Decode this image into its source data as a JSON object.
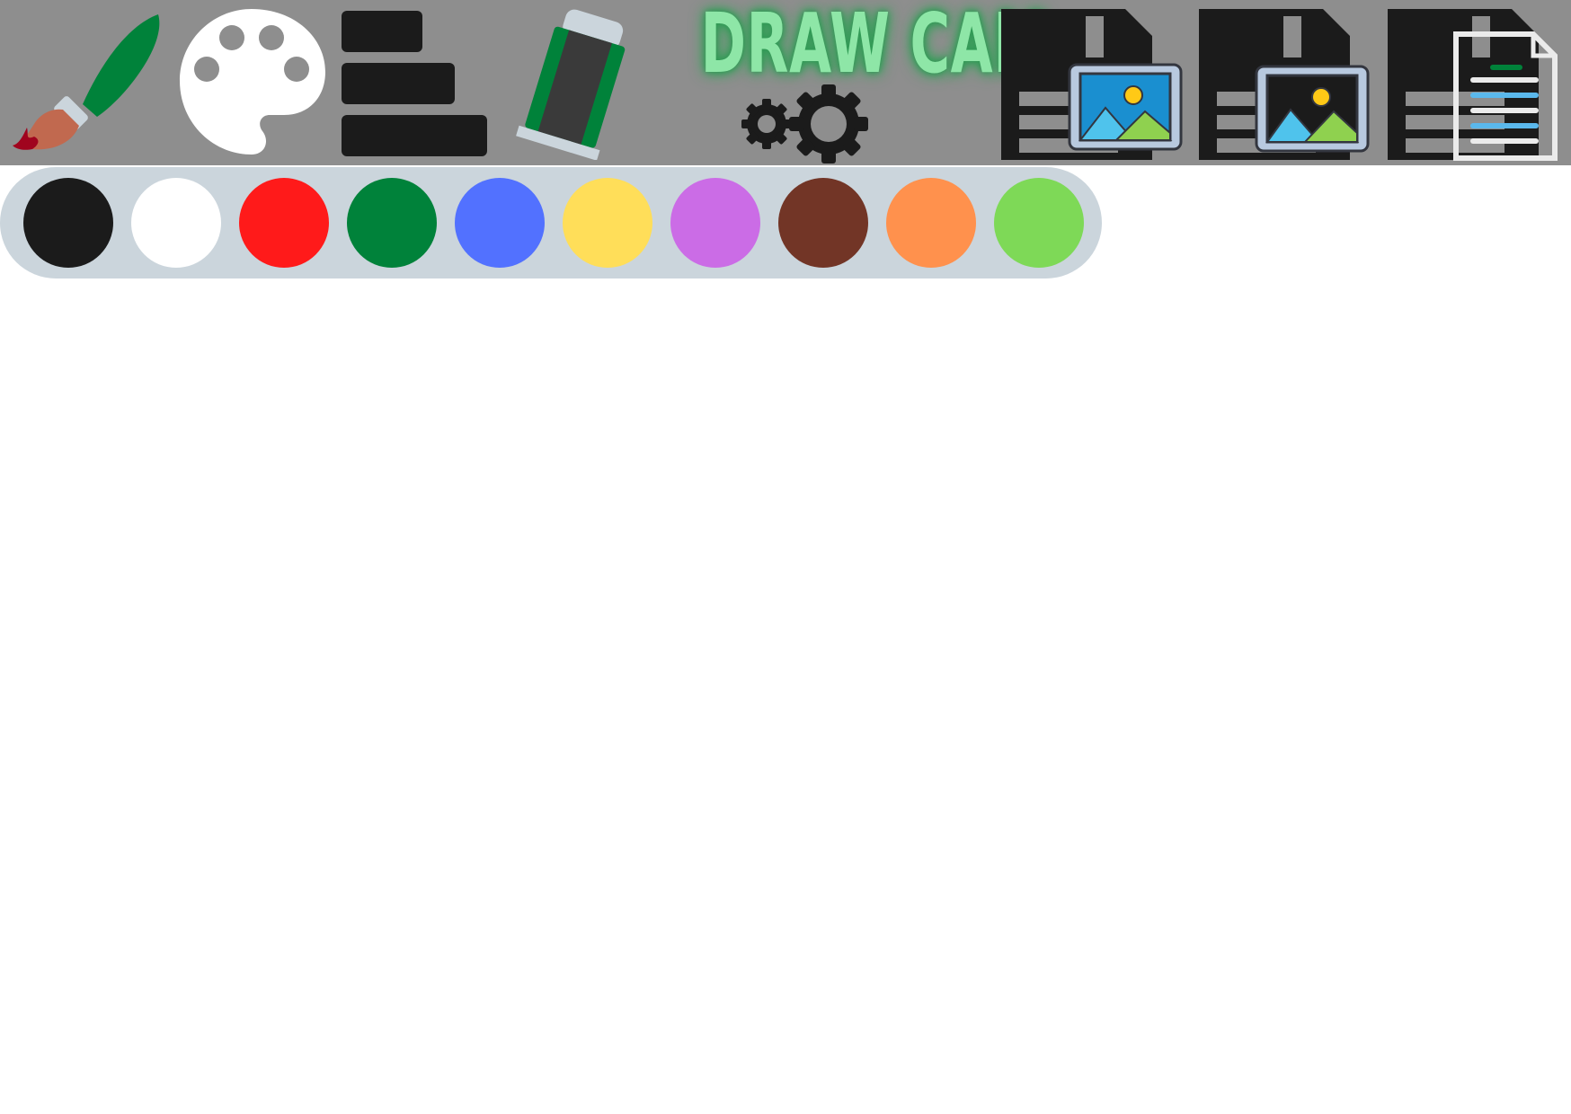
{
  "app": {
    "title": "DRAW CAM"
  },
  "toolbar": {
    "tools": [
      {
        "name": "brush-tool",
        "icon": "paintbrush-icon"
      },
      {
        "name": "color-palette-tool",
        "icon": "palette-icon"
      },
      {
        "name": "brush-size-tool",
        "icon": "line-width-icon"
      },
      {
        "name": "eraser-tool",
        "icon": "eraser-icon"
      },
      {
        "name": "settings-tool",
        "icon": "gears-icon"
      },
      {
        "name": "save-image-button",
        "icon": "floppy-image-icon"
      },
      {
        "name": "save-image-alt-button",
        "icon": "floppy-image-frame-icon"
      },
      {
        "name": "save-document-button",
        "icon": "floppy-document-icon"
      }
    ]
  },
  "palette": {
    "colors": [
      "#1b1b1b",
      "#ffffff",
      "#ff1a1a",
      "#00823a",
      "#5271ff",
      "#ffde59",
      "#cb6ce6",
      "#723526",
      "#ff914d",
      "#7ed957"
    ]
  }
}
